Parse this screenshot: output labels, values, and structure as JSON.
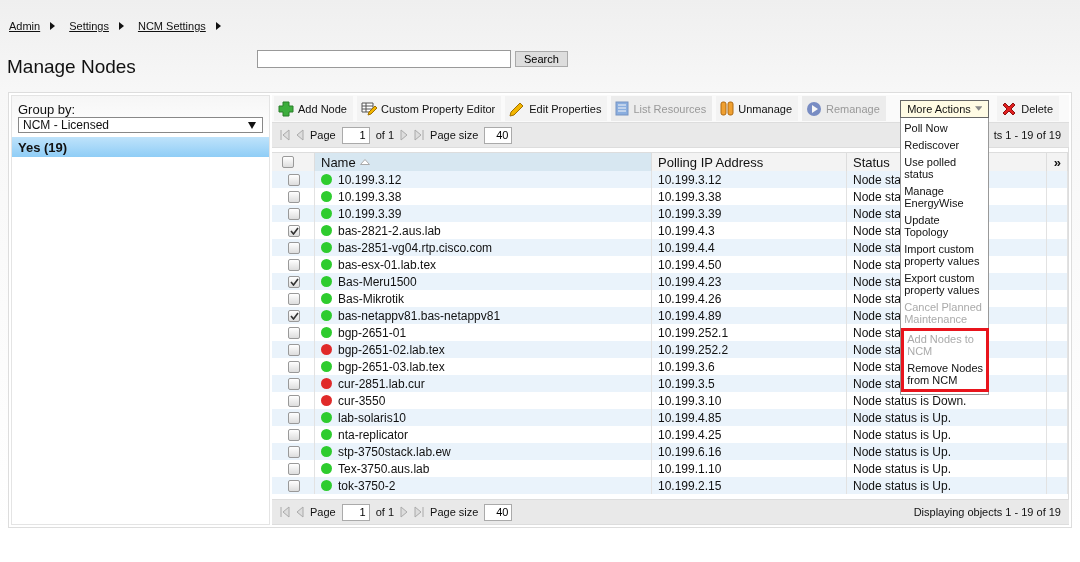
{
  "breadcrumb": [
    "Admin",
    "Settings",
    "NCM Settings"
  ],
  "title": "Manage Nodes",
  "search": {
    "button": "Search"
  },
  "sidebar": {
    "group_by_label": "Group by:",
    "group_by_value": "NCM - Licensed",
    "items": [
      {
        "label": "Yes (19)",
        "selected": true
      }
    ]
  },
  "toolbar": [
    {
      "kind": "add",
      "label": "Add Node",
      "disabled": false
    },
    {
      "kind": "custom",
      "label": "Custom Property Editor",
      "disabled": false
    },
    {
      "kind": "edit",
      "label": "Edit Properties",
      "disabled": false
    },
    {
      "kind": "list",
      "label": "List Resources",
      "disabled": true
    },
    {
      "kind": "unmanage",
      "label": "Unmanage",
      "disabled": false
    },
    {
      "kind": "remanage",
      "label": "Remanage",
      "disabled": true
    },
    {
      "kind": "menu",
      "label": "More Actions",
      "disabled": false
    },
    {
      "kind": "delete",
      "label": "Delete",
      "disabled": false
    }
  ],
  "paging_top": {
    "page_label": "Page",
    "page": "1",
    "of": "of 1",
    "size_label": "Page size",
    "size": "40",
    "display": "ts 1 - 19 of 19"
  },
  "table": {
    "select_all_checked": false,
    "columns": [
      "Name",
      "Polling IP Address",
      "Status"
    ],
    "more": "»",
    "rows": [
      {
        "checked": false,
        "color": "#2ecc2e",
        "name": "10.199.3.12",
        "ip": "10.199.3.12",
        "status": "Node sta"
      },
      {
        "checked": false,
        "color": "#2ecc2e",
        "name": "10.199.3.38",
        "ip": "10.199.3.38",
        "status": "Node sta"
      },
      {
        "checked": false,
        "color": "#2ecc2e",
        "name": "10.199.3.39",
        "ip": "10.199.3.39",
        "status": "Node sta"
      },
      {
        "checked": true,
        "color": "#2ecc2e",
        "name": "bas-2821-2.aus.lab",
        "ip": "10.199.4.3",
        "status": "Node sta"
      },
      {
        "checked": false,
        "color": "#2ecc2e",
        "name": "bas-2851-vg04.rtp.cisco.com",
        "ip": "10.199.4.4",
        "status": "Node sta"
      },
      {
        "checked": false,
        "color": "#2ecc2e",
        "name": "bas-esx-01.lab.tex",
        "ip": "10.199.4.50",
        "status": "Node sta"
      },
      {
        "checked": true,
        "color": "#2ecc2e",
        "name": "Bas-Meru1500",
        "ip": "10.199.4.23",
        "status": "Node sta"
      },
      {
        "checked": false,
        "color": "#2ecc2e",
        "name": "Bas-Mikrotik",
        "ip": "10.199.4.26",
        "status": "Node sta"
      },
      {
        "checked": true,
        "color": "#2ecc2e",
        "name": "bas-netappv81.bas-netappv81",
        "ip": "10.199.4.89",
        "status": "Node sta"
      },
      {
        "checked": false,
        "color": "#2ecc2e",
        "name": "bgp-2651-01",
        "ip": "10.199.252.1",
        "status": "Node sta"
      },
      {
        "checked": false,
        "color": "#e02a2a",
        "name": "bgp-2651-02.lab.tex",
        "ip": "10.199.252.2",
        "status": "Node sta"
      },
      {
        "checked": false,
        "color": "#2ecc2e",
        "name": "bgp-2651-03.lab.tex",
        "ip": "10.199.3.6",
        "status": "Node sta"
      },
      {
        "checked": false,
        "color": "#e02a2a",
        "name": "cur-2851.lab.cur",
        "ip": "10.199.3.5",
        "status": "Node sta"
      },
      {
        "checked": false,
        "color": "#e02a2a",
        "name": "cur-3550",
        "ip": "10.199.3.10",
        "status": "Node status is Down."
      },
      {
        "checked": false,
        "color": "#2ecc2e",
        "name": "lab-solaris10",
        "ip": "10.199.4.85",
        "status": "Node status is Up."
      },
      {
        "checked": false,
        "color": "#2ecc2e",
        "name": "nta-replicator",
        "ip": "10.199.4.25",
        "status": "Node status is Up."
      },
      {
        "checked": false,
        "color": "#2ecc2e",
        "name": "stp-3750stack.lab.ew",
        "ip": "10.199.6.16",
        "status": "Node status is Up."
      },
      {
        "checked": false,
        "color": "#2ecc2e",
        "name": "Tex-3750.aus.lab",
        "ip": "10.199.1.10",
        "status": "Node status is Up."
      },
      {
        "checked": false,
        "color": "#2ecc2e",
        "name": "tok-3750-2",
        "ip": "10.199.2.15",
        "status": "Node status is Up."
      }
    ]
  },
  "paging_bottom": {
    "page_label": "Page",
    "page": "1",
    "of": "of 1",
    "size_label": "Page size",
    "size": "40",
    "display": "Displaying objects 1 - 19 of 19"
  },
  "more_actions_menu": [
    {
      "label": "Poll Now",
      "disabled": false,
      "highlighted": false
    },
    {
      "label": "Rediscover",
      "disabled": false,
      "highlighted": false
    },
    {
      "label": "Use polled status",
      "disabled": false,
      "highlighted": false
    },
    {
      "label": "Manage EnergyWise",
      "disabled": false,
      "highlighted": false
    },
    {
      "label": "Update Topology",
      "disabled": false,
      "highlighted": false
    },
    {
      "label": "Import custom property values",
      "disabled": false,
      "highlighted": false
    },
    {
      "label": "Export custom property values",
      "disabled": false,
      "highlighted": false
    },
    {
      "label": "Cancel Planned Maintenance",
      "disabled": true,
      "highlighted": false
    },
    {
      "label": "Add Nodes to NCM",
      "disabled": true,
      "highlighted": true
    },
    {
      "label": "Remove Nodes from NCM",
      "disabled": false,
      "highlighted": true
    }
  ]
}
